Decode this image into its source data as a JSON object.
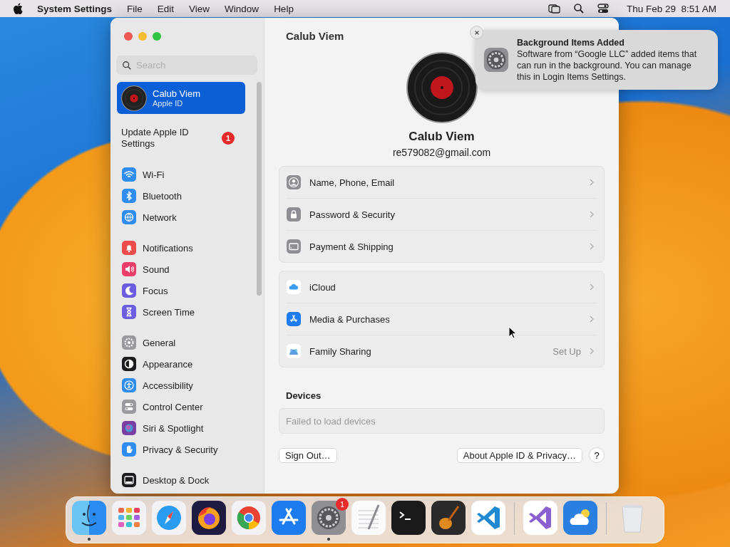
{
  "menu_bar": {
    "app_name": "System Settings",
    "menus": [
      "File",
      "Edit",
      "View",
      "Window",
      "Help"
    ],
    "clock": "Thu Feb 29  8:51 AM"
  },
  "sidebar": {
    "search": {
      "placeholder": "Search"
    },
    "account": {
      "name": "Calub Viem",
      "subtitle": "Apple ID",
      "selected": true
    },
    "update": {
      "label": "Update Apple ID Settings",
      "badge": "1"
    },
    "groups": [
      [
        {
          "label": "Wi-Fi",
          "kind": "wifi",
          "color": "#2f8cf0",
          "selected": false
        },
        {
          "label": "Bluetooth",
          "kind": "bluetooth",
          "color": "#2f8cf0",
          "selected": false
        },
        {
          "label": "Network",
          "kind": "network",
          "color": "#2f8cf0",
          "selected": false
        }
      ],
      [
        {
          "label": "Notifications",
          "kind": "bell",
          "color": "#ee4b4b",
          "selected": false
        },
        {
          "label": "Sound",
          "kind": "speaker",
          "color": "#ec3d6a",
          "selected": false
        },
        {
          "label": "Focus",
          "kind": "moon",
          "color": "#6c5ce0",
          "selected": false
        },
        {
          "label": "Screen Time",
          "kind": "hourglass",
          "color": "#6c5ce0",
          "selected": false
        }
      ],
      [
        {
          "label": "General",
          "kind": "gear",
          "color": "#9a9a9e",
          "selected": false
        },
        {
          "label": "Appearance",
          "kind": "appearance",
          "color": "#1c1c1e",
          "selected": false
        },
        {
          "label": "Accessibility",
          "kind": "accessibility",
          "color": "#2f8cf0",
          "selected": false
        },
        {
          "label": "Control Center",
          "kind": "toggles",
          "color": "#9a9a9e",
          "selected": false
        },
        {
          "label": "Siri & Spotlight",
          "kind": "siri",
          "color": "#7a3fa0",
          "selected": false
        },
        {
          "label": "Privacy & Security",
          "kind": "hand",
          "color": "#2f8cf0",
          "selected": false
        }
      ],
      [
        {
          "label": "Desktop & Dock",
          "kind": "dock",
          "color": "#1c1c1e",
          "selected": false
        }
      ]
    ]
  },
  "content": {
    "title": "Calub Viem",
    "profile": {
      "name": "Calub Viem",
      "email": "re579082@gmail.com"
    },
    "groups": [
      [
        {
          "label": "Name, Phone, Email",
          "kind": "person"
        },
        {
          "label": "Password & Security",
          "kind": "lock"
        },
        {
          "label": "Payment & Shipping",
          "kind": "card"
        }
      ],
      [
        {
          "label": "iCloud",
          "kind": "cloud"
        },
        {
          "label": "Media & Purchases",
          "kind": "store"
        },
        {
          "label": "Family Sharing",
          "kind": "family",
          "detail": "Set Up"
        }
      ]
    ],
    "devices": {
      "heading": "Devices",
      "message": "Failed to load devices"
    },
    "buttons": {
      "sign_out": "Sign Out…",
      "about": "About Apple ID & Privacy…",
      "help": "?"
    }
  },
  "notification": {
    "title": "Background Items Added",
    "body": "Software from “Google LLC” added items that can run in the background. You can manage this in Login Items Settings."
  },
  "dock": {
    "apps": [
      {
        "kind": "finder",
        "running": true
      },
      {
        "kind": "launchpad",
        "running": false
      },
      {
        "kind": "safari",
        "running": false
      },
      {
        "kind": "firefox",
        "running": false
      },
      {
        "kind": "chrome",
        "running": false
      },
      {
        "kind": "appstore",
        "running": false
      },
      {
        "kind": "settings",
        "running": true,
        "badge": "1"
      },
      {
        "kind": "textedit",
        "running": false
      },
      {
        "kind": "terminal",
        "running": false
      },
      {
        "kind": "garageband",
        "running": false
      },
      {
        "kind": "vscode",
        "running": false
      }
    ],
    "extras": [
      {
        "kind": "visualstudio",
        "running": false
      },
      {
        "kind": "weather",
        "running": false
      }
    ],
    "trash": {
      "kind": "trash"
    }
  }
}
